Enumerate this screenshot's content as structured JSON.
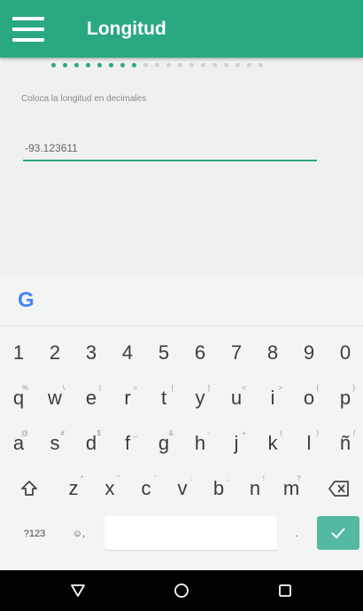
{
  "app": {
    "title": "Longitud",
    "accent": "#2aa883",
    "menu_icon": "hamburger-menu-icon"
  },
  "progress": {
    "total": 19,
    "completed": 8
  },
  "form": {
    "instruction": "Coloca la longitud en decimales",
    "longitude_value": "-93.123611"
  },
  "keyboard": {
    "logo": "G",
    "number_row": [
      "1",
      "2",
      "3",
      "4",
      "5",
      "6",
      "7",
      "8",
      "9",
      "0"
    ],
    "row1": [
      {
        "k": "q",
        "h": "%"
      },
      {
        "k": "w",
        "h": "\\"
      },
      {
        "k": "e",
        "h": "|"
      },
      {
        "k": "r",
        "h": "="
      },
      {
        "k": "t",
        "h": "["
      },
      {
        "k": "y",
        "h": "]"
      },
      {
        "k": "u",
        "h": "<"
      },
      {
        "k": "i",
        "h": ">"
      },
      {
        "k": "o",
        "h": "{"
      },
      {
        "k": "p",
        "h": "}"
      }
    ],
    "row2": [
      {
        "k": "a",
        "h": "@"
      },
      {
        "k": "s",
        "h": "#"
      },
      {
        "k": "d",
        "h": "$"
      },
      {
        "k": "f",
        "h": "_"
      },
      {
        "k": "g",
        "h": "&"
      },
      {
        "k": "h",
        "h": "-"
      },
      {
        "k": "j",
        "h": "+"
      },
      {
        "k": "k",
        "h": "("
      },
      {
        "k": "l",
        "h": ")"
      },
      {
        "k": "ñ",
        "h": "/"
      }
    ],
    "row3": [
      {
        "k": "z",
        "h": "*"
      },
      {
        "k": "x",
        "h": "\""
      },
      {
        "k": "c",
        "h": "'"
      },
      {
        "k": "v",
        "h": ":"
      },
      {
        "k": "b",
        "h": ";"
      },
      {
        "k": "n",
        "h": "!"
      },
      {
        "k": "m",
        "h": "?"
      }
    ],
    "symbols_label": "?123",
    "comma_key": "☺,",
    "period_key": ".",
    "shift_icon": "shift-icon",
    "backspace_icon": "backspace-icon",
    "enter_icon": "checkmark-icon",
    "enter_color": "#53b9a1"
  },
  "navbar": {
    "back_icon": "back-triangle-icon",
    "home_icon": "home-circle-icon",
    "recents_icon": "recents-square-icon"
  }
}
